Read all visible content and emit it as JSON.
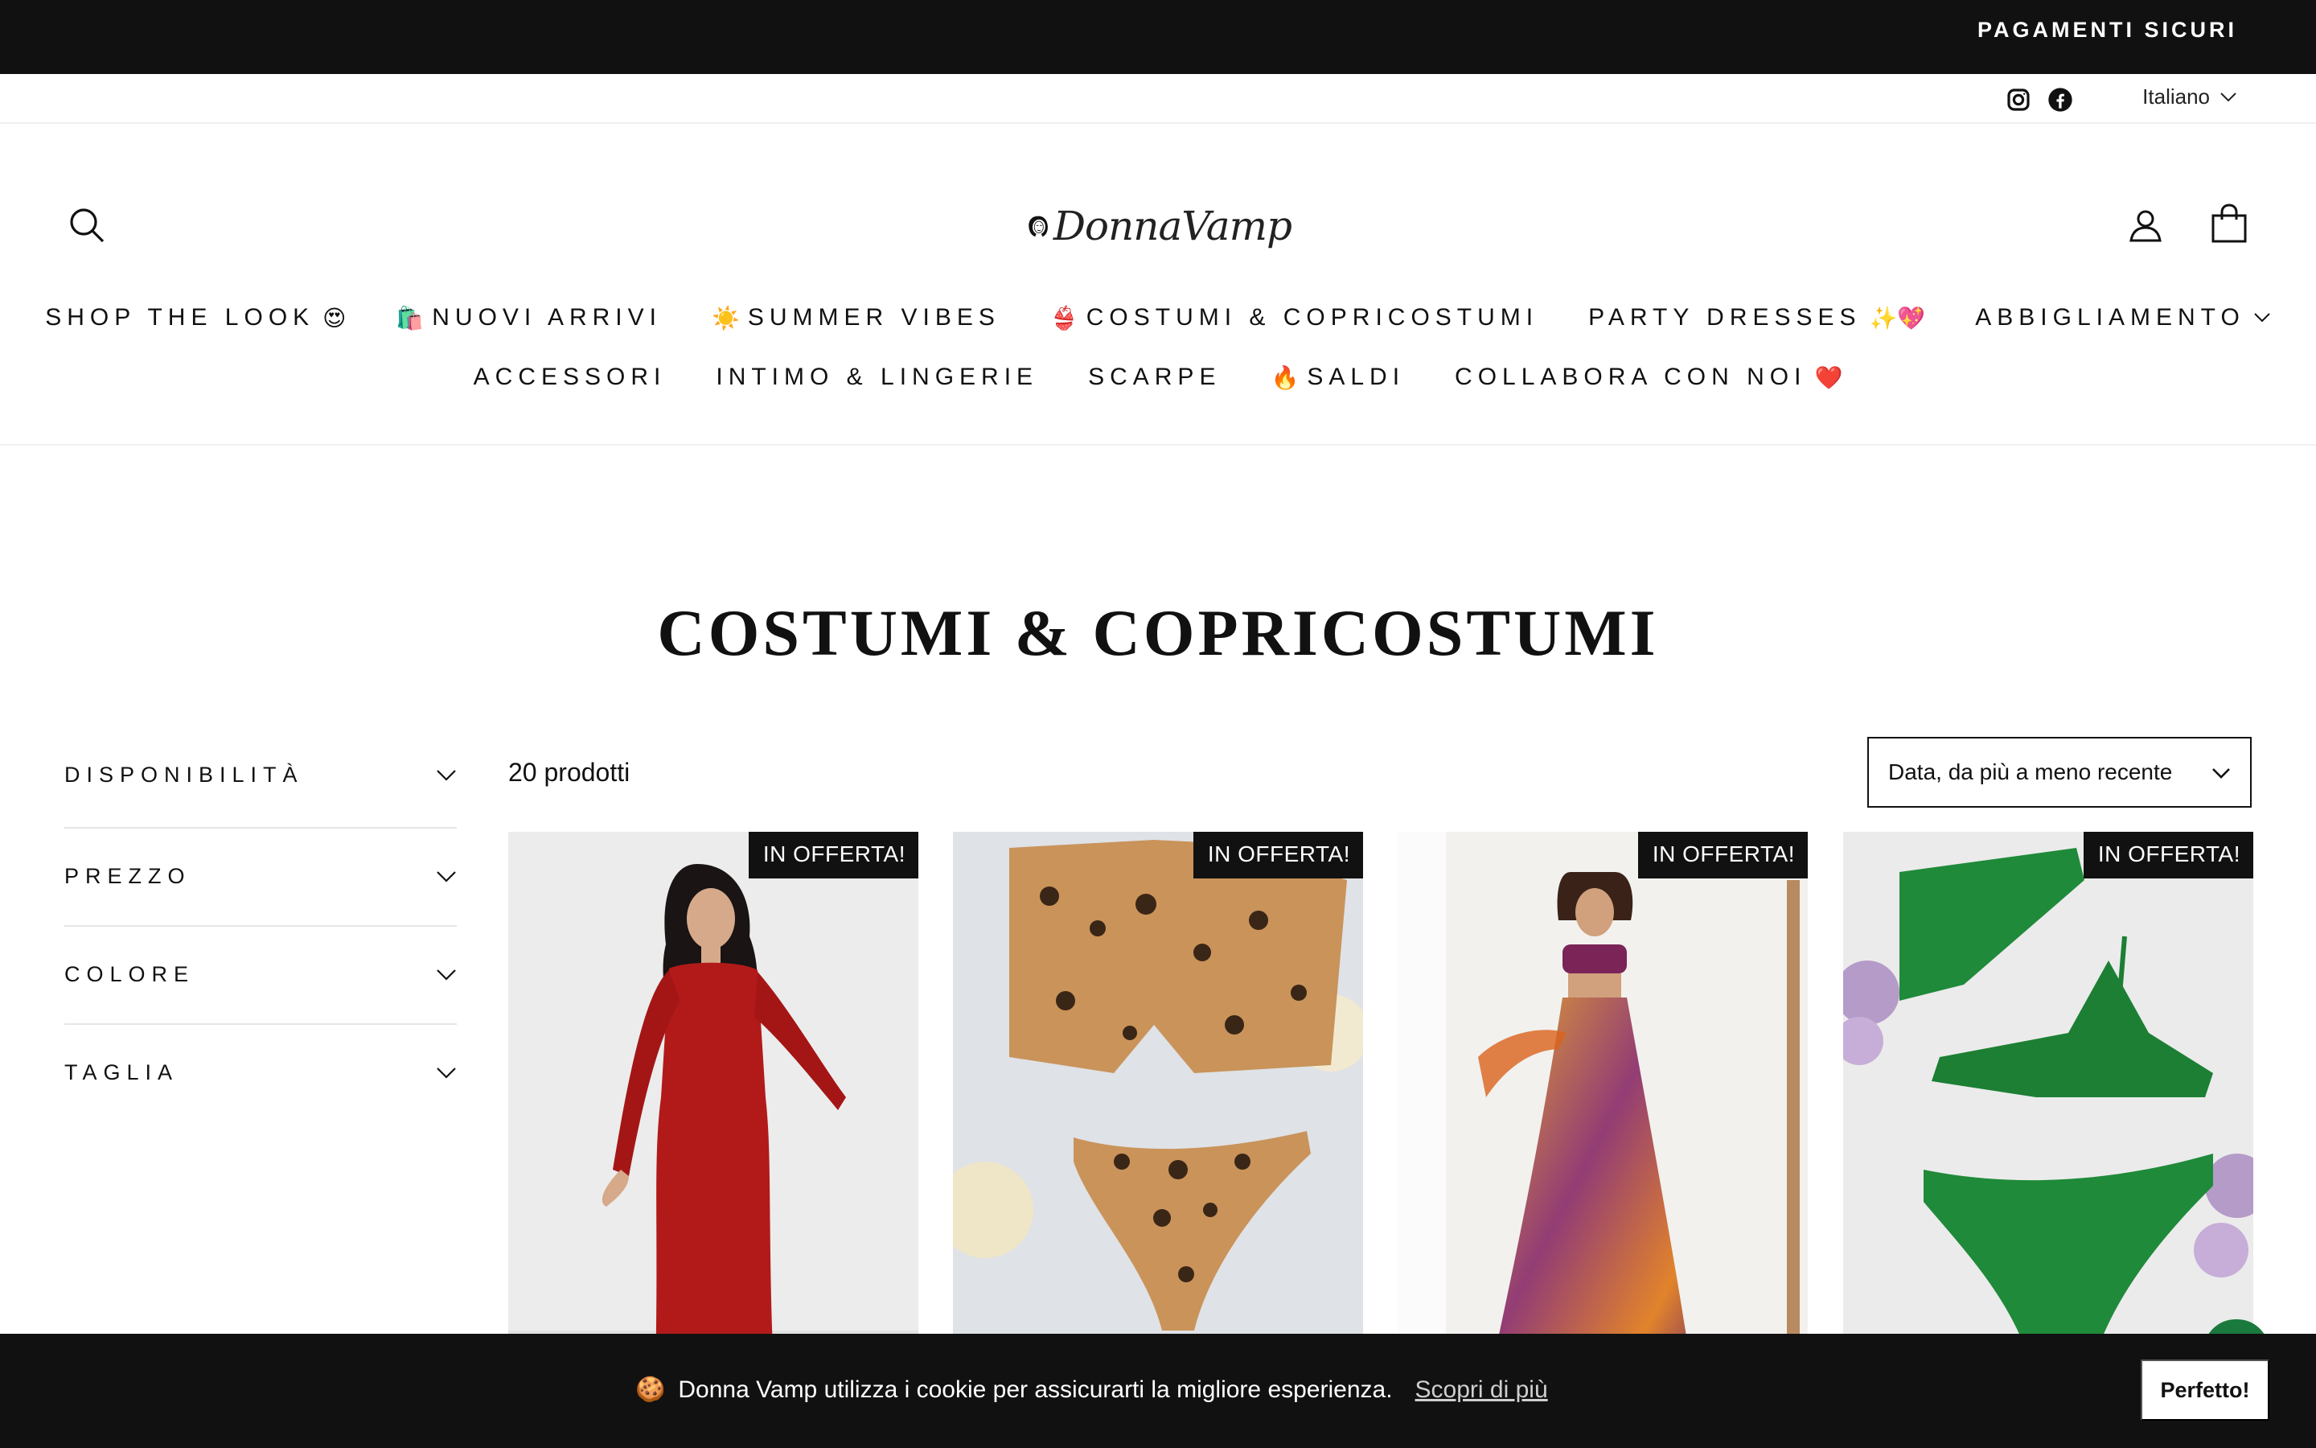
{
  "announcement": {
    "text": "PAGAMENTI SICURI"
  },
  "utility": {
    "language": "Italiano",
    "social_icons": [
      "instagram-icon",
      "facebook-icon"
    ]
  },
  "header": {
    "logo_text": "DonnaVamp",
    "icons": [
      "search-icon",
      "account-icon",
      "cart-icon"
    ]
  },
  "nav": {
    "row1": [
      {
        "label": "SHOP THE LOOK",
        "emoji_after": "😍"
      },
      {
        "label": "NUOVI ARRIVI",
        "emoji_before": "🛍️"
      },
      {
        "label": "SUMMER VIBES",
        "emoji_before": "☀️"
      },
      {
        "label": "COSTUMI & COPRICOSTUMI",
        "emoji_before": "👙"
      },
      {
        "label": "PARTY DRESSES",
        "emoji_after": "✨💖"
      },
      {
        "label": "ABBIGLIAMENTO"
      }
    ],
    "row2": [
      {
        "label": "ACCESSORI"
      },
      {
        "label": "INTIMO & LINGERIE"
      },
      {
        "label": "SCARPE"
      },
      {
        "label": "SALDI",
        "emoji_before": "🔥"
      },
      {
        "label": "COLLABORA CON NOI",
        "emoji_after": "❤️"
      }
    ]
  },
  "page": {
    "title": "COSTUMI & COPRICOSTUMI"
  },
  "filters": [
    {
      "label": "DISPONIBILITÀ"
    },
    {
      "label": "PREZZO"
    },
    {
      "label": "COLORE"
    },
    {
      "label": "TAGLIA"
    }
  ],
  "collection": {
    "count": "20 prodotti",
    "sort_selected": "Data, da più a meno recente"
  },
  "products": [
    {
      "badge": "IN OFFERTA!"
    },
    {
      "badge": "IN OFFERTA!"
    },
    {
      "badge": "IN OFFERTA!"
    },
    {
      "badge": "IN OFFERTA!"
    }
  ],
  "cookie": {
    "emoji": "🍪",
    "text": "Donna Vamp utilizza i cookie per assicurarti la migliore esperienza.",
    "link": "Scopri di più",
    "button": "Perfetto!"
  }
}
